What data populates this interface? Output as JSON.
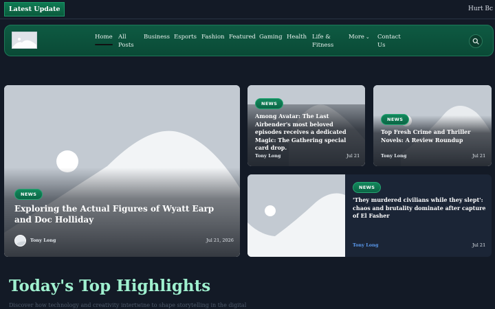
{
  "ticker": {
    "badge": "Latest Update",
    "text": "Hurt Bc"
  },
  "nav": {
    "items": [
      {
        "label": "Home",
        "active": true
      },
      {
        "label": "All Posts"
      },
      {
        "label": "Business"
      },
      {
        "label": "Esports"
      },
      {
        "label": "Fashion"
      },
      {
        "label": "Featured"
      },
      {
        "label": "Gaming"
      },
      {
        "label": "Health"
      },
      {
        "label": "Life & Fitness"
      },
      {
        "label": "More"
      },
      {
        "label": "Contact Us"
      }
    ],
    "icons": {
      "search": "search-icon",
      "more": "chevron-down-icon"
    }
  },
  "featured": {
    "badge": "NEWS",
    "title": "Exploring the Actual Figures of Wyatt Earp and Doc Holliday",
    "author": "Tony Long",
    "date": "Jul 21, 2026"
  },
  "card2": {
    "badge": "NEWS",
    "title": "Among Avatar: The Last Airbender's most beloved episodes receives a dedicated Magic: The Gathering special card drop.",
    "author": "Tony Long",
    "date": "Jul 21"
  },
  "card3": {
    "badge": "NEWS",
    "title": "Top Fresh Crime and Thriller Novels: A Review Roundup",
    "author": "Tony Long",
    "date": "Jul 21"
  },
  "card4": {
    "badge": "NEWS",
    "title": "'They murdered civilians while they slept': chaos and brutality dominate after capture of El Fasher",
    "author": "Tony Long",
    "date": "Jul 21"
  },
  "highlights": {
    "title": "Today's Top Highlights",
    "subtitle": "Discover how technology and creativity intertwine to shape storytelling in the digital"
  },
  "colors": {
    "accent": "#0f7a53",
    "heading": "#9ff0cf",
    "background": "#131a26",
    "author_link": "#5b9bf0"
  }
}
